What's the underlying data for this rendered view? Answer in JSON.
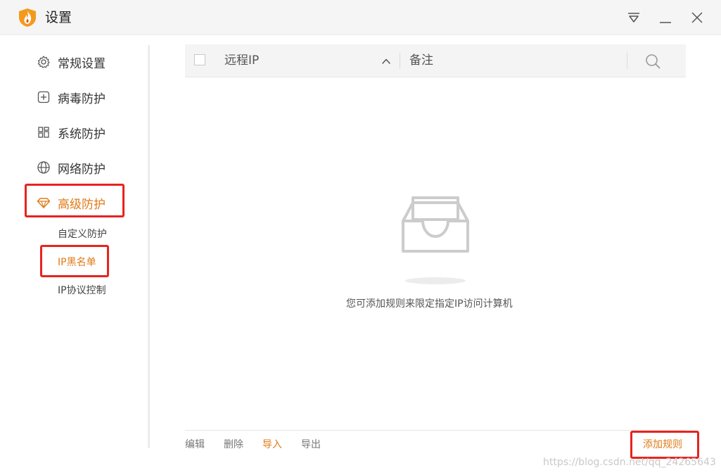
{
  "window": {
    "title": "设置",
    "icons": {
      "logo": "flame-shield-logo",
      "menu": "dropdown-menu-icon",
      "minimize": "minimize-icon",
      "close": "close-icon"
    },
    "colors": {
      "accent": "#e07a16",
      "highlight": "#e8231f",
      "titlebar": "#f5f5f5"
    }
  },
  "sidebar": {
    "items": [
      {
        "label": "常规设置",
        "icon": "gear-icon"
      },
      {
        "label": "病毒防护",
        "icon": "plus-square-icon"
      },
      {
        "label": "系统防护",
        "icon": "windows-icon"
      },
      {
        "label": "网络防护",
        "icon": "globe-icon"
      },
      {
        "label": "高级防护",
        "icon": "diamond-icon",
        "active": true
      }
    ],
    "sub_items": [
      {
        "label": "自定义防护"
      },
      {
        "label": "IP黑名单",
        "active": true
      },
      {
        "label": "IP协议控制"
      }
    ]
  },
  "table": {
    "columns": [
      "远程IP",
      "备注"
    ],
    "sort_icon": "chevron-up-icon",
    "search_icon": "search-icon"
  },
  "empty_state": {
    "icon": "empty-inbox-icon",
    "message": "您可添加规则来限定指定IP访问计算机"
  },
  "footer": {
    "actions": [
      "编辑",
      "删除",
      "导入",
      "导出"
    ],
    "add_rule": "添加规则"
  },
  "watermark": "https://blog.csdn.net/qq_24265643"
}
